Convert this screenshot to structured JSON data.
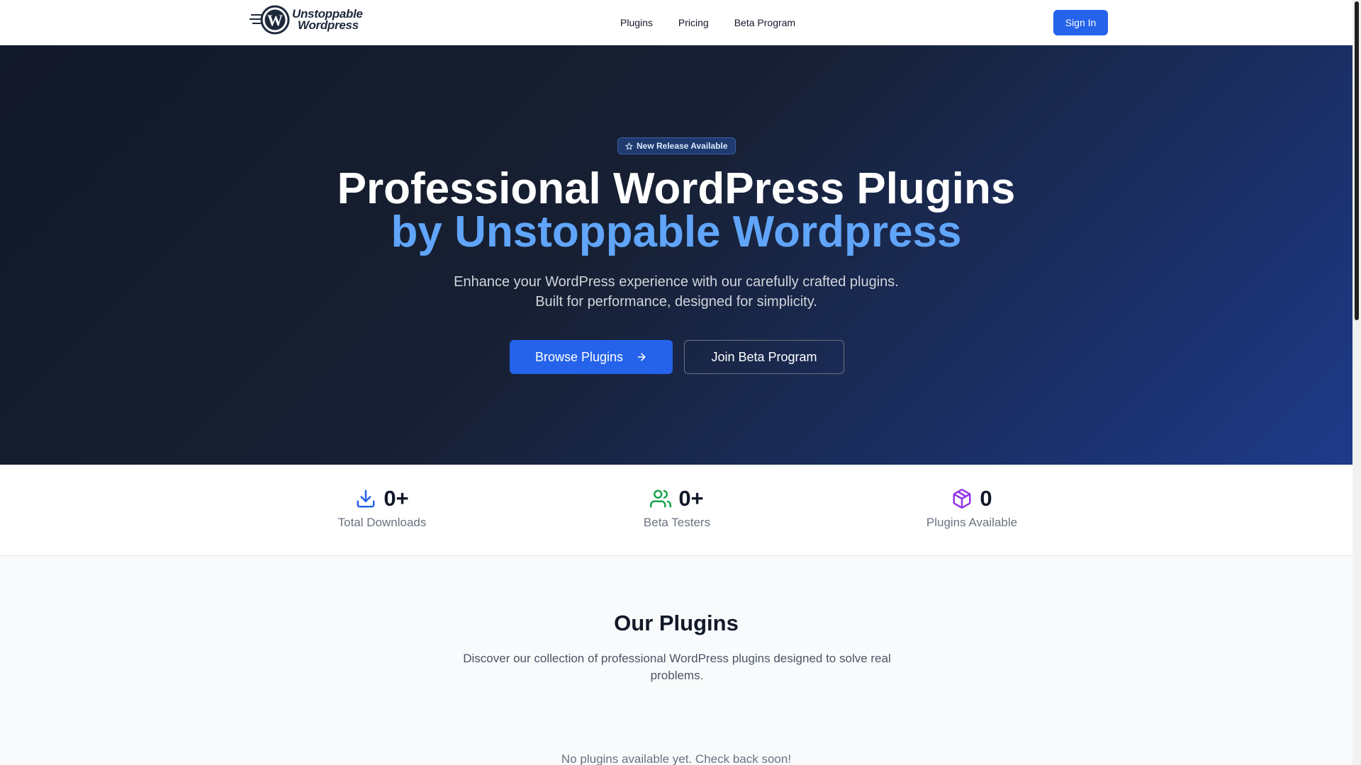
{
  "header": {
    "logo": {
      "line1": "Unstoppable",
      "line2": "Wordpress",
      "mark_letter": "W"
    },
    "nav": [
      {
        "label": "Plugins"
      },
      {
        "label": "Pricing"
      },
      {
        "label": "Beta Program"
      }
    ],
    "sign_in_label": "Sign In"
  },
  "hero": {
    "badge": "New Release Available",
    "title_line1": "Professional WordPress Plugins",
    "title_line2": "by Unstoppable Wordpress",
    "subtitle_line1": "Enhance your WordPress experience with our carefully crafted plugins.",
    "subtitle_line2": "Built for performance, designed for simplicity.",
    "primary_button": "Browse Plugins",
    "secondary_button": "Join Beta Program"
  },
  "stats": [
    {
      "value": "0+",
      "label": "Total Downloads",
      "icon": "download-icon",
      "color": "#2563eb"
    },
    {
      "value": "0+",
      "label": "Beta Testers",
      "icon": "users-icon",
      "color": "#16a34a"
    },
    {
      "value": "0",
      "label": "Plugins Available",
      "icon": "package-icon",
      "color": "#9333ea"
    }
  ],
  "plugins": {
    "title": "Our Plugins",
    "description": "Discover our collection of professional WordPress plugins designed to solve real problems.",
    "empty_message": "No plugins available yet. Check back soon!"
  },
  "colors": {
    "accent": "#2563eb",
    "hero_highlight": "#60a5fa",
    "hero_dark": "#111827"
  }
}
